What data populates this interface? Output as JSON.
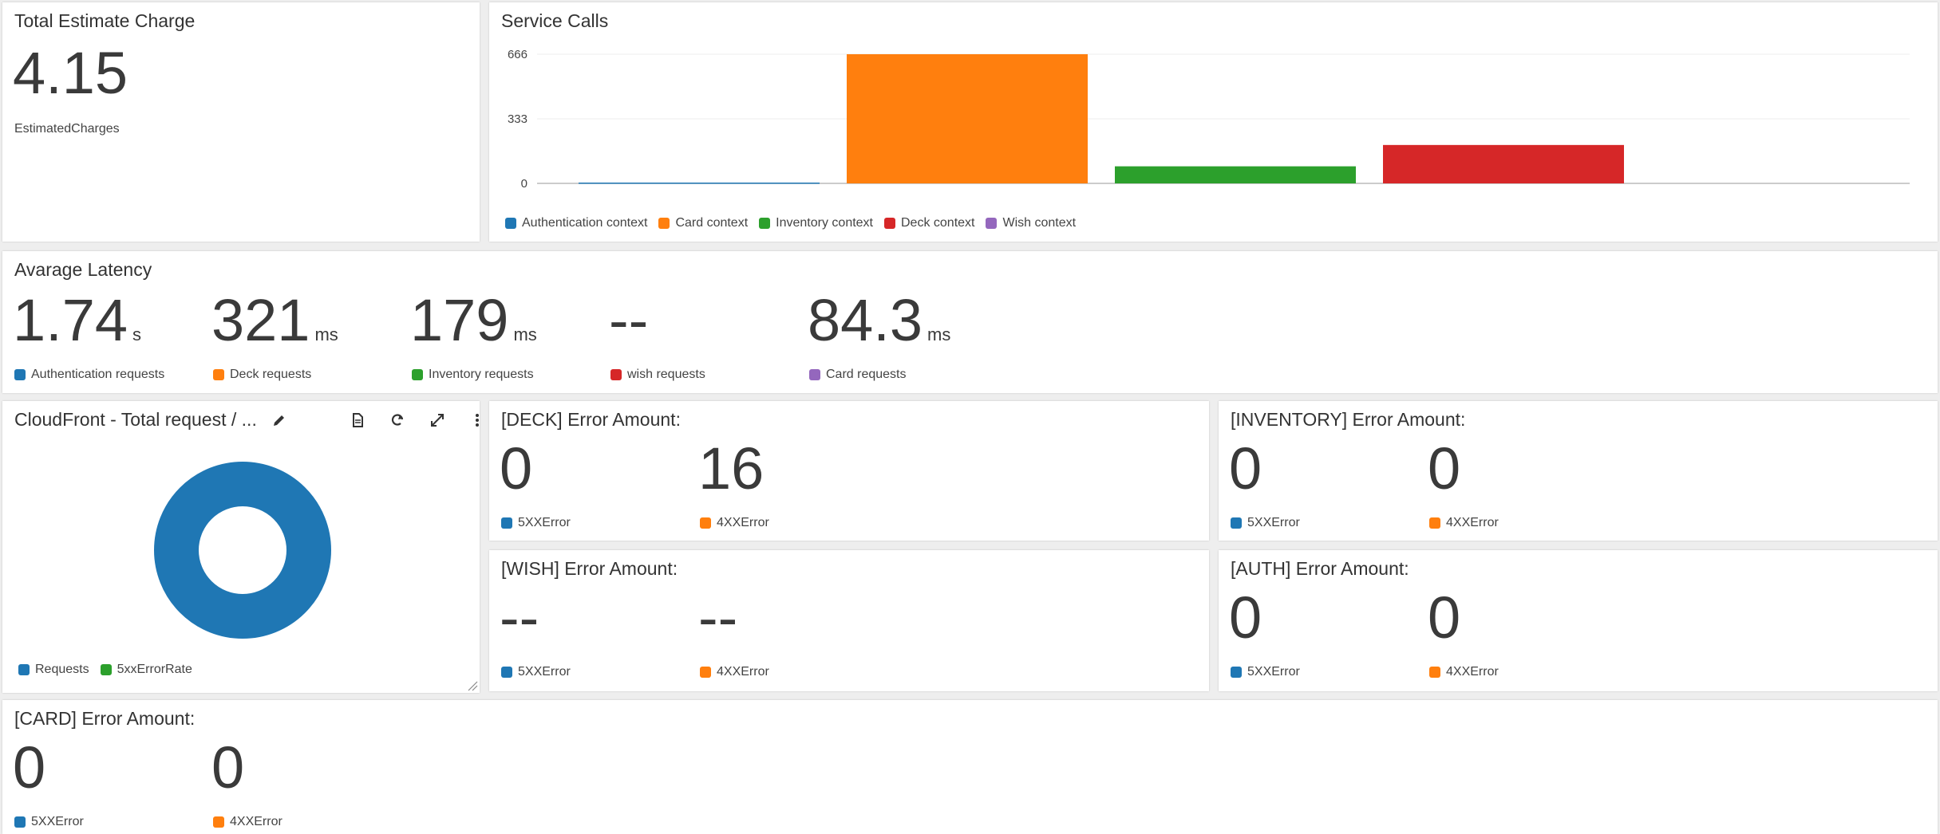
{
  "colors": {
    "blue": "#1f77b4",
    "orange": "#ff7f0e",
    "green": "#2ca02c",
    "red": "#d62728",
    "purple": "#9467bd"
  },
  "estimate": {
    "title": "Total Estimate Charge",
    "value": "4.15",
    "label": "EstimatedCharges"
  },
  "service_calls": {
    "title": "Service Calls",
    "chart_data": {
      "type": "bar",
      "categories": [
        "Authentication context",
        "Card context",
        "Inventory context",
        "Deck context",
        "Wish context"
      ],
      "values": [
        2,
        666,
        88,
        198,
        0
      ],
      "yticks": [
        "666",
        "333",
        "0"
      ],
      "ylim": [
        0,
        666
      ],
      "grid": true,
      "legend": "bottom-left"
    },
    "legend": [
      {
        "label": "Authentication context",
        "color": "#1f77b4"
      },
      {
        "label": "Card context",
        "color": "#ff7f0e"
      },
      {
        "label": "Inventory context",
        "color": "#2ca02c"
      },
      {
        "label": "Deck context",
        "color": "#d62728"
      },
      {
        "label": "Wish context",
        "color": "#9467bd"
      }
    ]
  },
  "latency": {
    "title": "Avarage Latency",
    "metrics": [
      {
        "value": "1.74",
        "unit": "s",
        "label": "Authentication requests",
        "color": "#1f77b4"
      },
      {
        "value": "321",
        "unit": "ms",
        "label": "Deck requests",
        "color": "#ff7f0e"
      },
      {
        "value": "179",
        "unit": "ms",
        "label": "Inventory requests",
        "color": "#2ca02c"
      },
      {
        "value": "--",
        "unit": "",
        "label": "wish requests",
        "color": "#d62728"
      },
      {
        "value": "84.3",
        "unit": "ms",
        "label": "Card requests",
        "color": "#9467bd"
      }
    ]
  },
  "cloudfront": {
    "title": "CloudFront - Total request / ...",
    "icons": [
      "pencil-icon",
      "document-icon",
      "refresh-icon",
      "expand-icon",
      "more-vertical-icon"
    ],
    "chart_data": {
      "type": "pie",
      "categories": [
        "Requests",
        "5xxErrorRate"
      ],
      "values": [
        100,
        0
      ]
    },
    "legend": [
      {
        "label": "Requests",
        "color": "#1f77b4"
      },
      {
        "label": "5xxErrorRate",
        "color": "#2ca02c"
      }
    ]
  },
  "errors": {
    "deck": {
      "title": "[DECK] Error Amount:",
      "e5": "0",
      "e4": "16"
    },
    "inventory": {
      "title": "[INVENTORY] Error Amount:",
      "e5": "0",
      "e4": "0"
    },
    "wish": {
      "title": "[WISH] Error Amount:",
      "e5": "--",
      "e4": "--"
    },
    "auth": {
      "title": "[AUTH] Error Amount:",
      "e5": "0",
      "e4": "0"
    },
    "card": {
      "title": "[CARD] Error Amount:",
      "e5": "0",
      "e4": "0"
    },
    "label5": "5XXError",
    "label4": "4XXError"
  }
}
